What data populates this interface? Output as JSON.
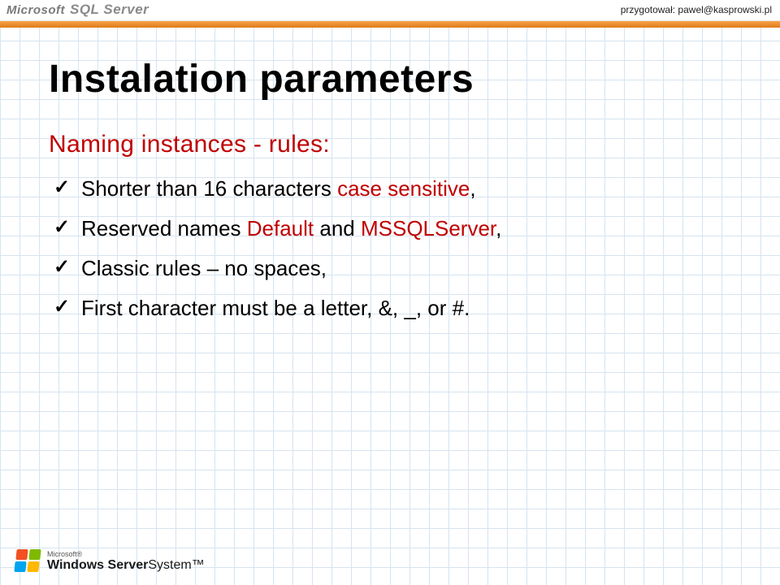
{
  "header": {
    "logo_ms": "Microsoft",
    "logo_product": "SQL Server",
    "prepared_by": "przygotował: pawel@kasprowski.pl"
  },
  "content": {
    "title": "Instalation parameters",
    "subtitle": "Naming instances - rules:",
    "bullets": [
      {
        "pre": "Shorter than 16 characters ",
        "hl": "case sensitive",
        "post": ","
      },
      {
        "pre": "Reserved names ",
        "hl": "Default",
        "mid": " and ",
        "hl2": "MSSQLServer",
        "post": ","
      },
      {
        "pre": "Classic rules – no spaces,",
        "hl": "",
        "post": ""
      },
      {
        "pre": "First character must be a letter, &, _, or #.",
        "hl": "",
        "post": ""
      }
    ]
  },
  "footer": {
    "ms_small": "Microsoft®",
    "product_bold": "Windows Server",
    "product_thin": "System™"
  }
}
